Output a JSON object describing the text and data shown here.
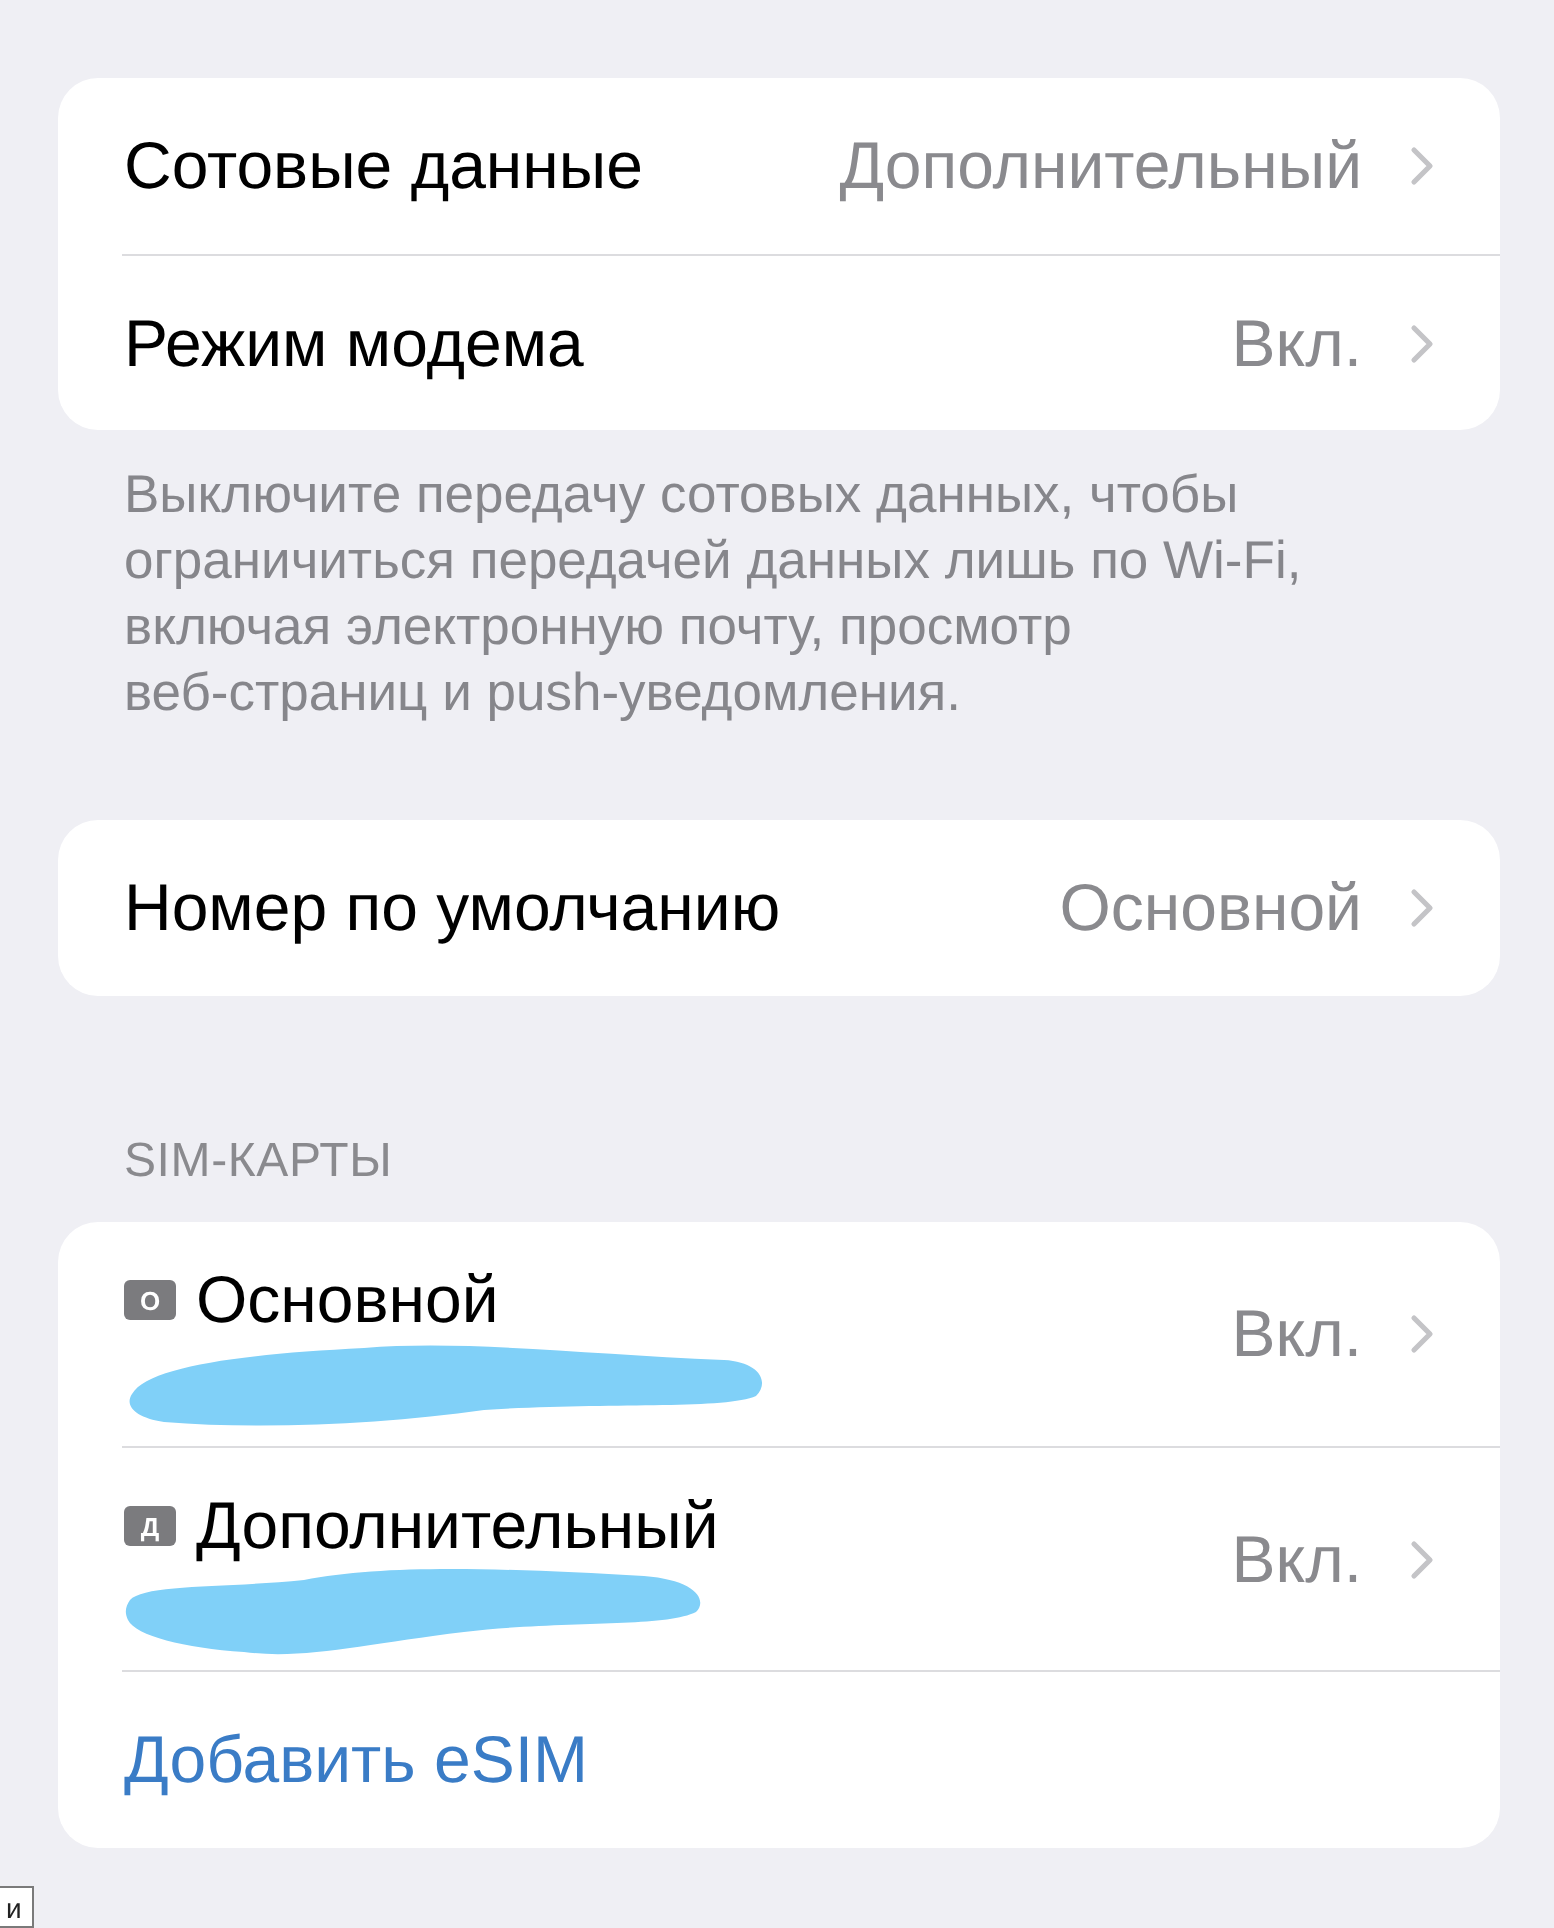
{
  "cellular": {
    "rows": [
      {
        "label": "Сотовые данные",
        "value": "Дополнительный"
      },
      {
        "label": "Режим модема",
        "value": "Вкл."
      }
    ],
    "footer": "Выключите передачу сотовых данных, чтобы ограничиться передачей данных лишь по Wi-Fi, включая электронную почту, просмотр веб-страниц и push-уведомления."
  },
  "default_number": {
    "rows": [
      {
        "label": "Номер по умолчанию",
        "value": "Основной"
      }
    ]
  },
  "sim_cards": {
    "header": "SIM-КАРТЫ",
    "items": [
      {
        "badge": "О",
        "name": "Основной",
        "value": "Вкл."
      },
      {
        "badge": "Д",
        "name": "Дополнительный",
        "value": "Вкл."
      }
    ],
    "add_link": "Добавить eSIM"
  },
  "edge_fragment": "и"
}
